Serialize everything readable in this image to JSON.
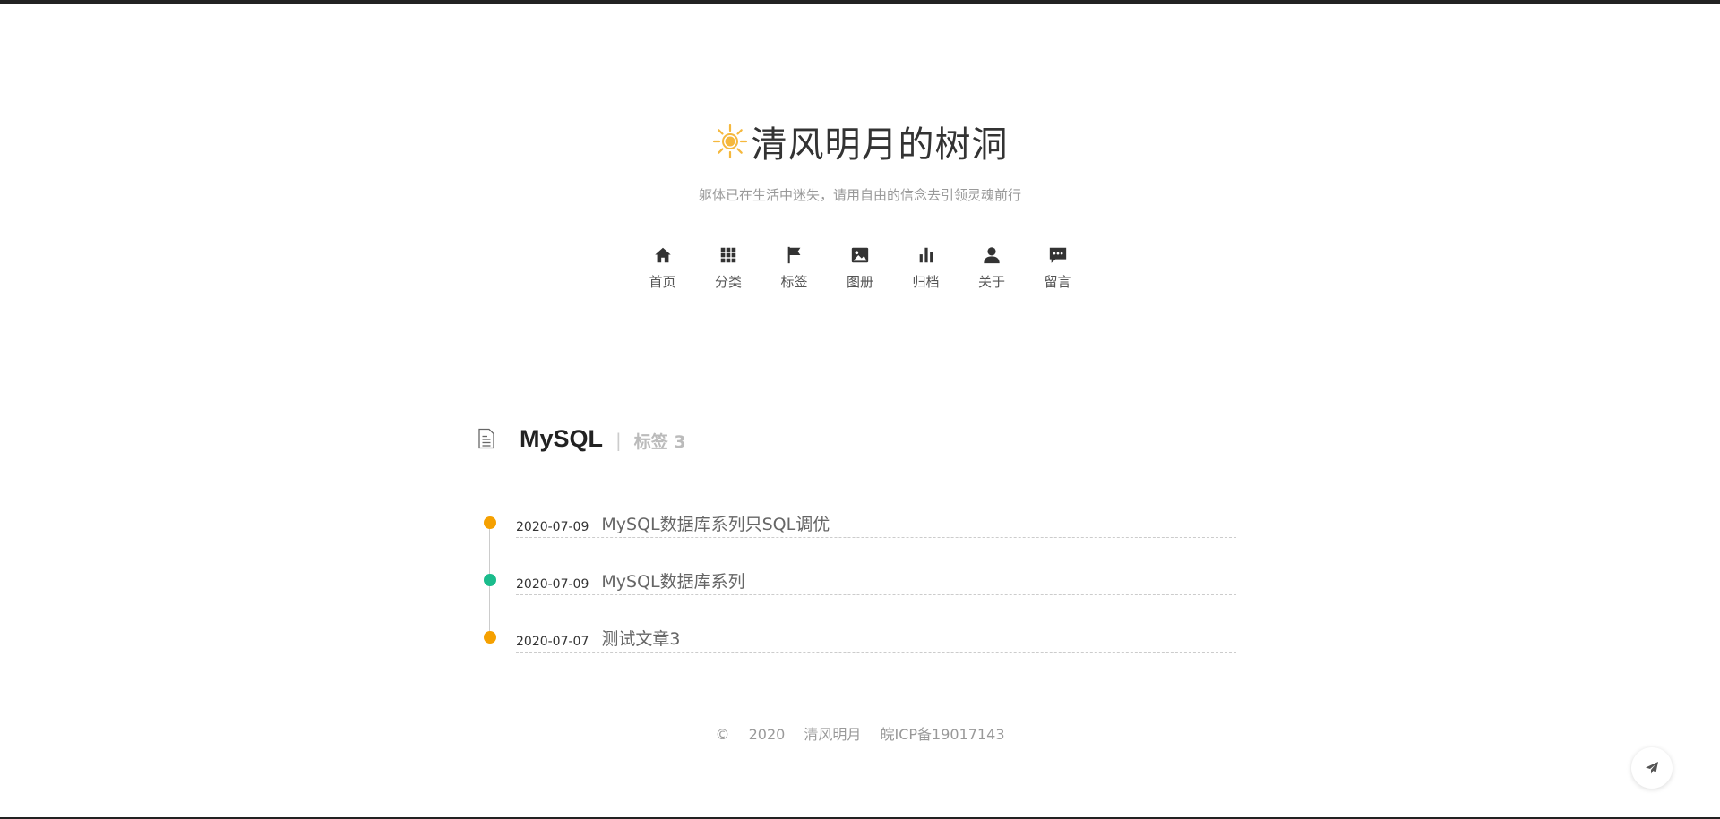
{
  "site": {
    "title": "清风明月的树洞",
    "subtitle": "躯体已在生活中迷失，请用自由的信念去引领灵魂前行",
    "logo_icon": "sun-icon",
    "accent_color": "#f5b83d"
  },
  "nav": {
    "items": [
      {
        "label": "首页",
        "icon": "home-icon"
      },
      {
        "label": "分类",
        "icon": "grid-icon"
      },
      {
        "label": "标签",
        "icon": "flag-icon"
      },
      {
        "label": "图册",
        "icon": "image-icon"
      },
      {
        "label": "归档",
        "icon": "bar-chart-icon"
      },
      {
        "label": "关于",
        "icon": "user-icon"
      },
      {
        "label": "留言",
        "icon": "comment-icon"
      }
    ]
  },
  "tag": {
    "icon": "document-icon",
    "name": "MySQL",
    "separator": "|",
    "count_label": "标签 3"
  },
  "posts": [
    {
      "date": "2020-07-09",
      "title": "MySQL数据库系列只SQL调优",
      "dot_color": "#f5a000"
    },
    {
      "date": "2020-07-09",
      "title": "MySQL数据库系列",
      "dot_color": "#1abc8c"
    },
    {
      "date": "2020-07-07",
      "title": "测试文章3",
      "dot_color": "#f5a000"
    }
  ],
  "footer": {
    "copyright": "©",
    "year": "2020",
    "author": "清风明月",
    "icp": "皖ICP备19017143"
  },
  "fab": {
    "icon": "paper-plane-icon"
  }
}
